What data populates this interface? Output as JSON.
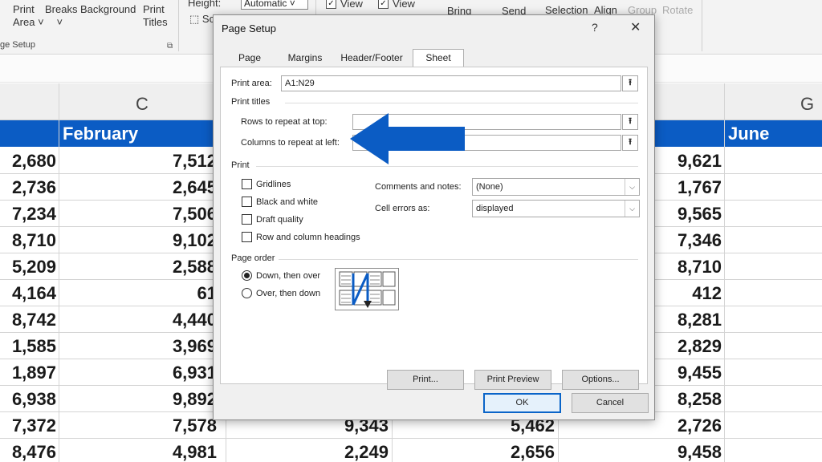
{
  "ribbon": {
    "print_area": "Print",
    "print_area_2": "Area",
    "breaks": "Breaks",
    "background": "Background",
    "print_titles": "Print",
    "print_titles_2": "Titles",
    "group_label": "ge Setup",
    "height_label": "Height:",
    "height_value": "Automatic",
    "scale_fragment": "Sc",
    "view_1": "View",
    "view_2": "View",
    "bring": "Bring",
    "send": "Send",
    "selection": "Selection",
    "align": "Align",
    "group": "Group",
    "rotate": "Rotate"
  },
  "grid": {
    "col_letters": {
      "C": "C",
      "G": "G"
    },
    "headers": {
      "february": "February",
      "june": "June"
    },
    "col_a": [
      "2,680",
      "2,736",
      "7,234",
      "8,710",
      "5,209",
      "4,164",
      "8,742",
      "1,585",
      "1,897",
      "6,938",
      "7,372",
      "8,476"
    ],
    "col_b": [
      "7,512",
      "2,645",
      "7,506",
      "9,102",
      "2,588",
      "61",
      "4,440",
      "3,969",
      "6,931",
      "9,892",
      "7,578",
      "4,981"
    ],
    "col_d_tail": [
      "9,343",
      "2,249"
    ],
    "col_e_tail": [
      "5,462",
      "2,656"
    ],
    "col_f": [
      "9,621",
      "1,767",
      "9,565",
      "7,346",
      "8,710",
      "412",
      "8,281",
      "2,829",
      "9,455",
      "8,258",
      "2,726",
      "9,458"
    ]
  },
  "dialog": {
    "title": "Page Setup",
    "help": "?",
    "close": "✕",
    "tabs": [
      "Page",
      "Margins",
      "Header/Footer",
      "Sheet"
    ],
    "print_area_label": "Print area:",
    "print_area_value": "A1:N29",
    "print_titles_section": "Print titles",
    "rows_repeat_label": "Rows to repeat at top:",
    "cols_repeat_label": "Columns to repeat at left:",
    "print_section": "Print",
    "gridlines": "Gridlines",
    "black_white": "Black and white",
    "draft_quality": "Draft quality",
    "row_col_headings": "Row and column headings",
    "comments_label": "Comments and notes:",
    "comments_value": "(None)",
    "errors_label": "Cell errors as:",
    "errors_value": "displayed",
    "page_order_section": "Page order",
    "down_then_over": "Down, then over",
    "over_then_down": "Over, then down",
    "print_btn": "Print...",
    "preview_btn": "Print Preview",
    "options_btn": "Options...",
    "ok_btn": "OK",
    "cancel_btn": "Cancel",
    "collapse_glyph": "⭱"
  },
  "colors": {
    "header_blue": "#0b5cc4",
    "arrow_blue": "#0b5cc4"
  }
}
